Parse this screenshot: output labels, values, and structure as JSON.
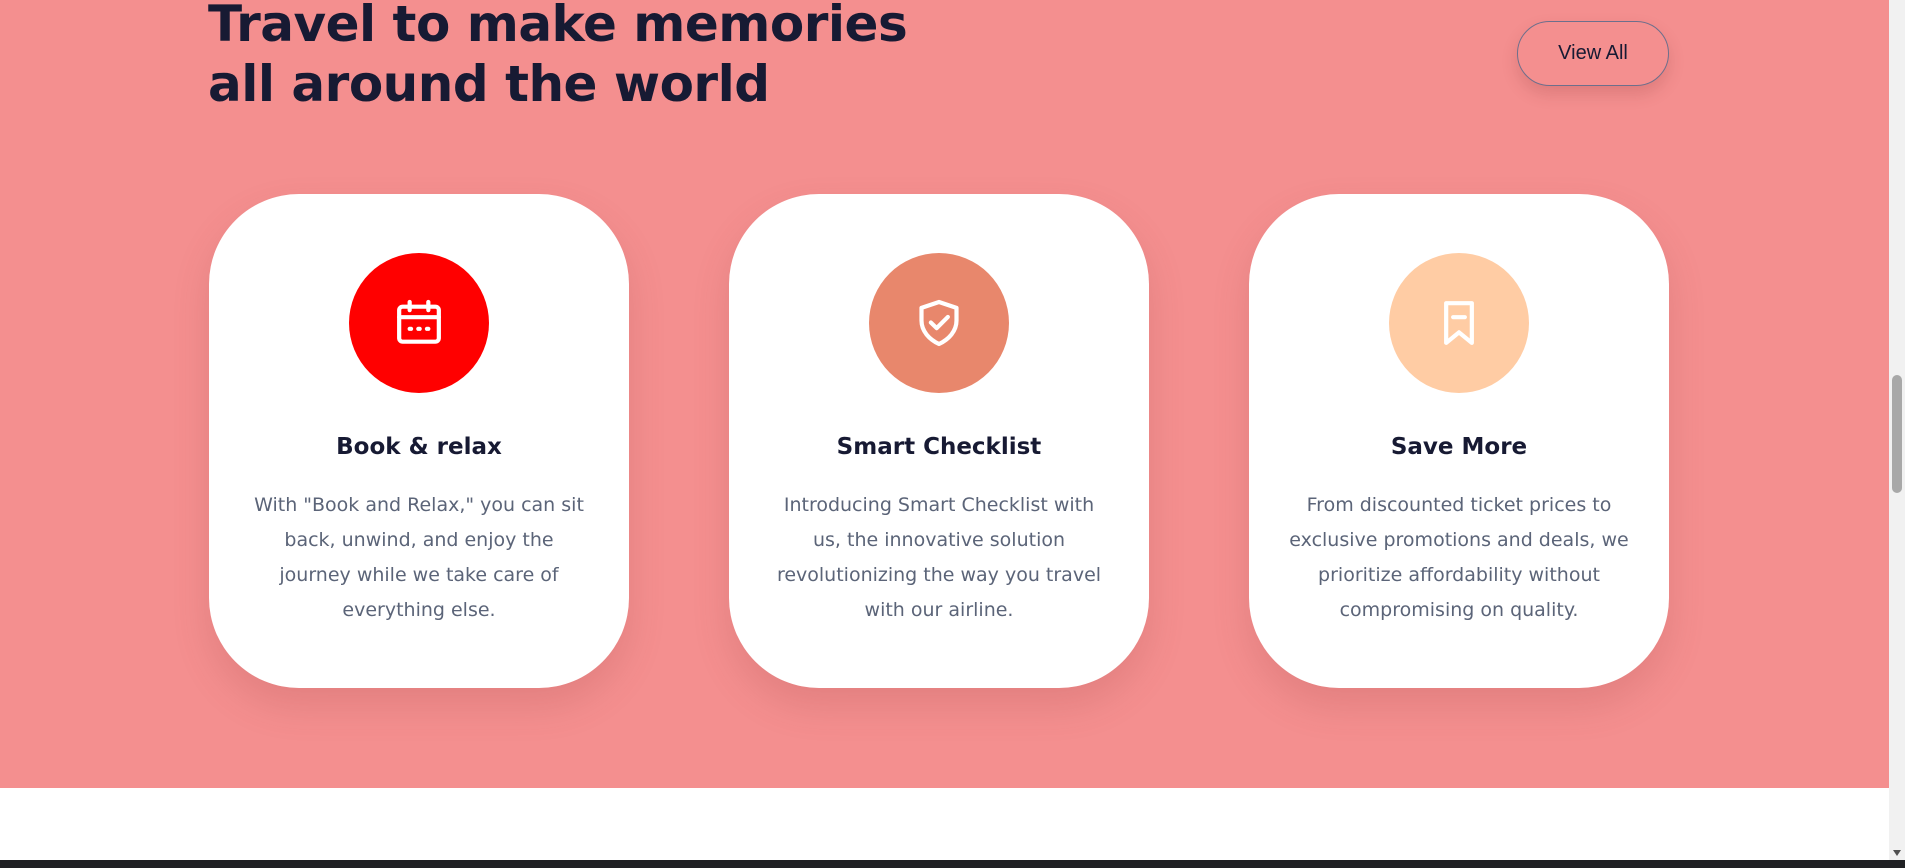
{
  "section": {
    "heading": "Travel to make memories all around the world",
    "view_all_label": "View All",
    "background": "#f48f8f"
  },
  "cards": [
    {
      "title": "Book & relax",
      "text": "With \"Book and Relax,\" you can sit back, unwind, and enjoy the journey while we take care of everything else.",
      "icon": "calendar-icon",
      "color": "#ff0000"
    },
    {
      "title": "Smart Checklist",
      "text": "Introducing Smart Checklist with us, the innovative solution revolutionizing the way you travel with our airline.",
      "icon": "shield-check-icon",
      "color": "#e8876c"
    },
    {
      "title": "Save More",
      "text": "From discounted ticket prices to exclusive promotions and deals, we prioritize affordability without compromising on quality.",
      "icon": "bookmark-icon",
      "color": "#ffcca4"
    }
  ]
}
